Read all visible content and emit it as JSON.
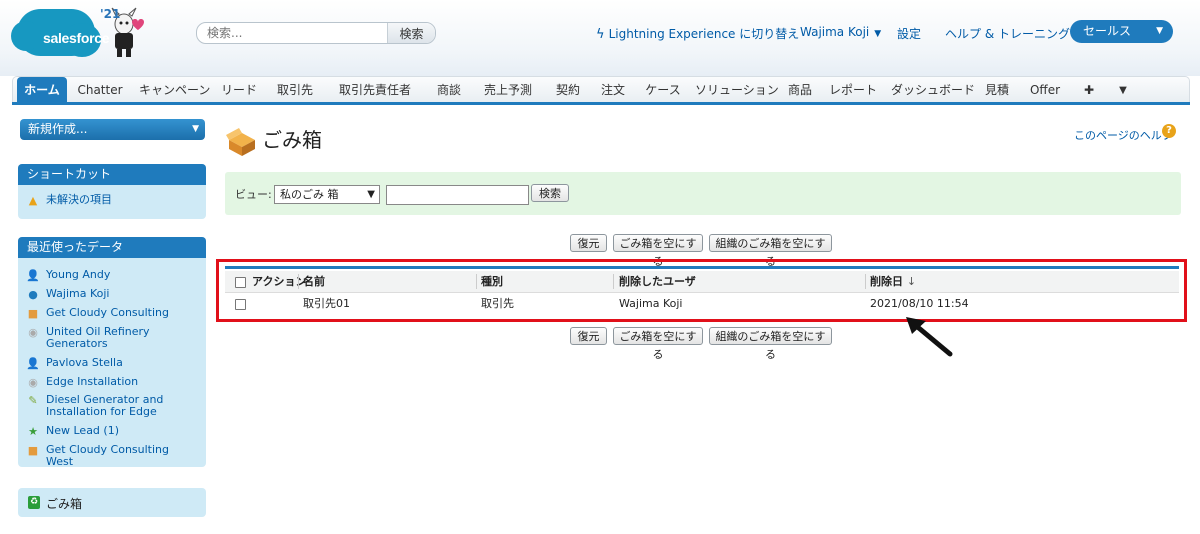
{
  "header": {
    "logo_text": "salesforce",
    "logo_year": "'21",
    "search": {
      "placeholder": "検索...",
      "button": "検索"
    },
    "switch_link": "Lightning Experience に切り替え",
    "user_name": "Wajima Koji",
    "settings_link": "設定",
    "help_link": "ヘルプ & トレーニング",
    "app_menu": "セールス"
  },
  "tabs": [
    "ホーム",
    "Chatter",
    "キャンペーン",
    "リード",
    "取引先",
    "取引先責任者",
    "商談",
    "売上予測",
    "契約",
    "注文",
    "ケース",
    "ソリューション",
    "商品",
    "レポート",
    "ダッシュボード",
    "見積",
    "Offer",
    "✚",
    "▼"
  ],
  "sidebar": {
    "new_button": "新規作成...",
    "shortcut_title": "ショートカット",
    "shortcut_items": [
      "未解決の項目"
    ],
    "recent_title": "最近使ったデータ",
    "recent_items": [
      {
        "label": "Young Andy",
        "icon": "person-icon"
      },
      {
        "label": "Wajima Koji",
        "icon": "user-icon"
      },
      {
        "label": "Get Cloudy Consulting",
        "icon": "opportunity-icon"
      },
      {
        "label": "United Oil Refinery Generators",
        "icon": "product-icon"
      },
      {
        "label": "Pavlova Stella",
        "icon": "person-icon"
      },
      {
        "label": "Edge Installation",
        "icon": "product-icon"
      },
      {
        "label": "Diesel Generator and Installation for Edge",
        "icon": "quote-icon"
      },
      {
        "label": "New Lead (1)",
        "icon": "lead-icon"
      },
      {
        "label": "Get Cloudy Consulting West",
        "icon": "opportunity-icon"
      }
    ],
    "trash_label": "ごみ箱"
  },
  "main": {
    "title": "ごみ箱",
    "help_link": "このページのヘルプ",
    "view_label": "ビュー:",
    "view_value": "私のごみ 箱",
    "search_button": "検索",
    "buttons": {
      "restore": "復元",
      "empty": "ごみ箱を空にする",
      "empty_org": "組織のごみ箱を空にする"
    },
    "table": {
      "headers": {
        "action": "アクション",
        "name": "名前",
        "type": "種別",
        "deleted_by": "削除したユーザ",
        "deleted_date": "削除日",
        "sort_indicator": "↓"
      },
      "rows": [
        {
          "name": "取引先01",
          "type": "取引先",
          "deleted_by": "Wajima Koji",
          "deleted_date": "2021/08/10 11:54"
        }
      ]
    }
  },
  "colors": {
    "brand": "#1f7bbd",
    "highlight": "#e1101a",
    "filter_bg": "#e3f6e3",
    "sidebar_bg": "#cfeaf6"
  }
}
